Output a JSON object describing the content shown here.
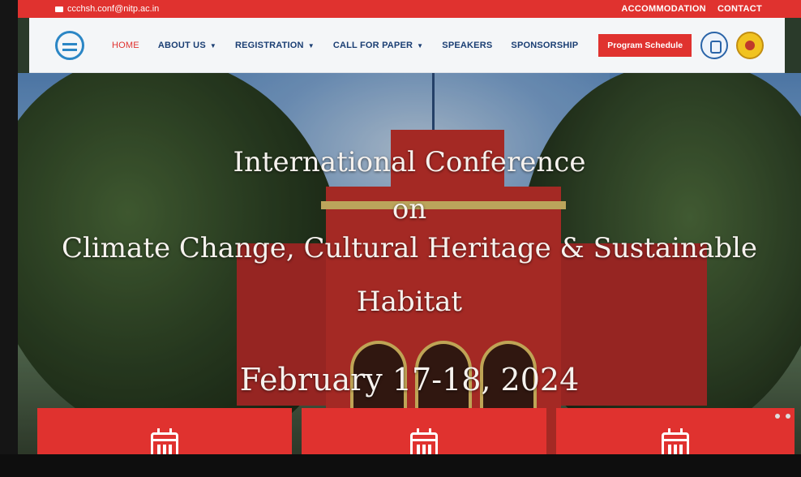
{
  "topbar": {
    "email": "ccchsh.conf@nitp.ac.in",
    "links": [
      "ACCOMMODATION",
      "CONTACT"
    ]
  },
  "nav": {
    "items": [
      {
        "label": "HOME",
        "dropdown": false
      },
      {
        "label": "ABOUT US",
        "dropdown": true
      },
      {
        "label": "REGISTRATION",
        "dropdown": true
      },
      {
        "label": "CALL FOR PAPER",
        "dropdown": true
      },
      {
        "label": "SPEAKERS",
        "dropdown": false
      },
      {
        "label": "SPONSORSHIP",
        "dropdown": false
      }
    ],
    "program_button": "Program Schedule"
  },
  "hero": {
    "line1": "International Conference",
    "line2": "on",
    "line3": "Climate Change, Cultural Heritage & Sustainable",
    "line4": "Habitat",
    "date": "February 17-18, 2024"
  },
  "icons": {
    "mail": "mail-icon",
    "calendar": "calendar-icon",
    "chevron": "chevron-down-icon"
  },
  "colors": {
    "accent": "#e0322f",
    "nav_text": "#1a3e73",
    "nav_bg": "#f4f6f8"
  }
}
